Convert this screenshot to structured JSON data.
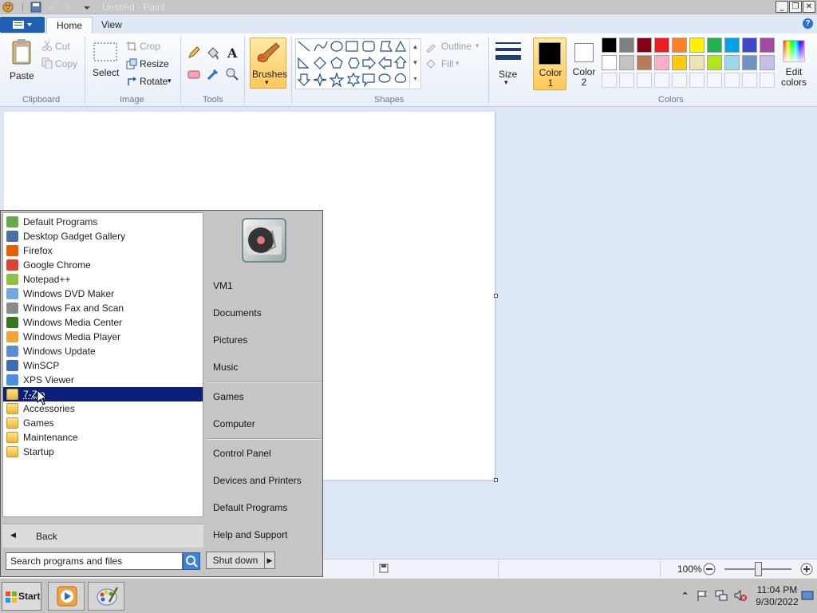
{
  "window": {
    "title": "Untitled - Paint"
  },
  "tabs": [
    {
      "label": "Home"
    },
    {
      "label": "View"
    }
  ],
  "ribbon": {
    "clipboard": {
      "paste": "Paste",
      "cut": "Cut",
      "copy": "Copy",
      "group": "Clipboard"
    },
    "image": {
      "select": "Select",
      "crop": "Crop",
      "resize": "Resize",
      "rotate": "Rotate",
      "group": "Image"
    },
    "tools": {
      "group": "Tools"
    },
    "brushes": "Brushes",
    "shapes": {
      "outline": "Outline",
      "fill": "Fill",
      "group": "Shapes"
    },
    "size": "Size",
    "color1": "Color 1",
    "color2": "Color 2",
    "edit_colors": "Edit colors",
    "colors_group": "Colors",
    "palette_row1": [
      "#000000",
      "#7f7f7f",
      "#880015",
      "#ed1c24",
      "#ff7f27",
      "#fff200",
      "#22b14c",
      "#00a2e8",
      "#3f48cc",
      "#a349a4"
    ],
    "palette_row2": [
      "#ffffff",
      "#c3c3c3",
      "#b97a57",
      "#ffaec9",
      "#ffc90e",
      "#efe4b0",
      "#b5e61d",
      "#99d9ea",
      "#7092be",
      "#c8bfe7"
    ],
    "active_color1": "#000000",
    "active_color2": "#ffffff"
  },
  "status": {
    "zoom": "100%"
  },
  "start_menu": {
    "programs": [
      {
        "label": "Default Programs",
        "icon": "default-programs-icon",
        "color": "#6aa84f"
      },
      {
        "label": "Desktop Gadget Gallery",
        "icon": "gadget-icon",
        "color": "#4a6fa5"
      },
      {
        "label": "Firefox",
        "icon": "firefox-icon",
        "color": "#e66000"
      },
      {
        "label": "Google Chrome",
        "icon": "chrome-icon",
        "color": "#db4437"
      },
      {
        "label": "Notepad++",
        "icon": "notepadpp-icon",
        "color": "#90c040"
      },
      {
        "label": "Windows DVD Maker",
        "icon": "dvd-maker-icon",
        "color": "#6fa8dc"
      },
      {
        "label": "Windows Fax and Scan",
        "icon": "fax-icon",
        "color": "#8a8a8a"
      },
      {
        "label": "Windows Media Center",
        "icon": "media-center-icon",
        "color": "#38761d"
      },
      {
        "label": "Windows Media Player",
        "icon": "media-player-icon",
        "color": "#f1a33c"
      },
      {
        "label": "Windows Update",
        "icon": "windows-update-icon",
        "color": "#5b8dd6"
      },
      {
        "label": "WinSCP",
        "icon": "winscp-icon",
        "color": "#3d6cb4"
      },
      {
        "label": "XPS Viewer",
        "icon": "xps-viewer-icon",
        "color": "#4a90e2"
      }
    ],
    "folders": [
      {
        "label": "7-Zip",
        "selected": true
      },
      {
        "label": "Accessories",
        "selected": false
      },
      {
        "label": "Games",
        "selected": false
      },
      {
        "label": "Maintenance",
        "selected": false
      },
      {
        "label": "Startup",
        "selected": false
      }
    ],
    "back": "Back",
    "search_placeholder": "Search programs and files",
    "right_items": [
      "VM1",
      "Documents",
      "Pictures",
      "Music",
      "Games",
      "Computer",
      "Control Panel",
      "Devices and Printers",
      "Default Programs",
      "Help and Support"
    ],
    "shutdown": "Shut down"
  },
  "taskbar": {
    "start": "Start",
    "time": "11:04 PM",
    "date": "9/30/2022"
  }
}
